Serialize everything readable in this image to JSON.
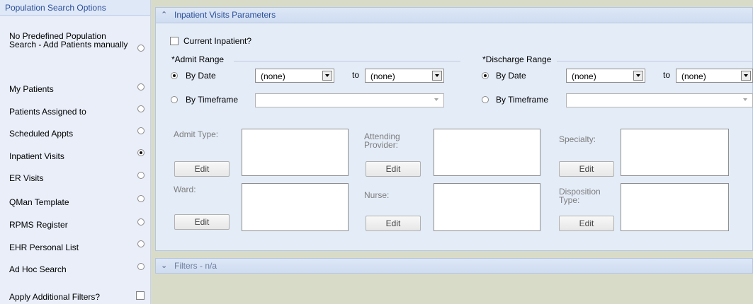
{
  "left_panel": {
    "header": "Population Search Options",
    "options": [
      {
        "label": "No Predefined Population Search - Add Patients manually",
        "selected": false
      },
      {
        "label": "My Patients",
        "selected": false
      },
      {
        "label": "Patients Assigned to",
        "selected": false
      },
      {
        "label": "Scheduled Appts",
        "selected": false
      },
      {
        "label": "Inpatient Visits",
        "selected": true
      },
      {
        "label": "ER Visits",
        "selected": false
      },
      {
        "label": "QMan Template",
        "selected": false
      },
      {
        "label": "RPMS Register",
        "selected": false
      },
      {
        "label": "EHR Personal List",
        "selected": false
      },
      {
        "label": "Ad Hoc Search",
        "selected": false
      }
    ],
    "apply_filters_label": "Apply Additional Filters?",
    "apply_filters_checked": false
  },
  "params": {
    "header": "Inpatient Visits Parameters",
    "current_inpatient_label": "Current Inpatient?",
    "current_inpatient_checked": false,
    "admit_range": {
      "title": "*Admit Range",
      "by_date_label": "By Date",
      "by_date_selected": true,
      "from_value": "(none)",
      "to_label": "to",
      "to_value": "(none)",
      "by_timeframe_label": "By Timeframe",
      "by_timeframe_selected": false,
      "timeframe_value": ""
    },
    "discharge_range": {
      "title": "*Discharge Range",
      "by_date_label": "By Date",
      "by_date_selected": true,
      "from_value": "(none)",
      "to_label": "to",
      "to_value": "(none)",
      "by_timeframe_label": "By Timeframe",
      "by_timeframe_selected": false,
      "timeframe_value": ""
    },
    "fields": {
      "admit_type": "Admit Type:",
      "attending_provider_1": "Attending",
      "attending_provider_2": "Provider:",
      "specialty": "Specialty:",
      "ward": "Ward:",
      "nurse": "Nurse:",
      "disposition_type_1": "Disposition",
      "disposition_type_2": "Type:"
    },
    "edit_label": "Edit"
  },
  "filters": {
    "header": "Filters - n/a"
  }
}
